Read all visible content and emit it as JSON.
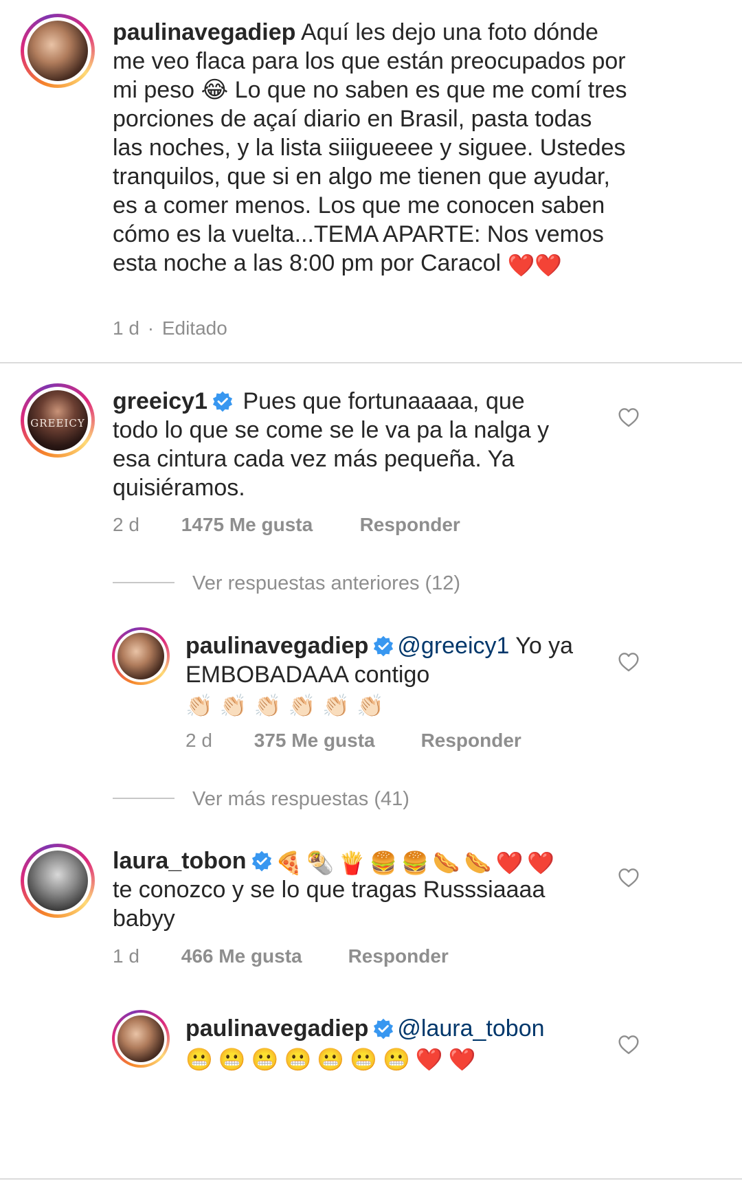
{
  "caption": {
    "username": "paulinavegadiep",
    "text": "Aquí les dejo una foto dónde me veo flaca para los que están  preocupados por mi peso 😂 Lo que no saben es que me comí tres porciones de açaí diario en Brasil, pasta todas las noches, y la lista siiigueeee y siguee. Ustedes tranquilos, que si en algo me tienen que ayudar, es a comer menos. Los que me conocen saben cómo es la vuelta...TEMA APARTE: Nos vemos esta noche a las 8:00 pm por Caracol ",
    "text_emoji": "❤️❤️",
    "time": "1 d",
    "edited": "Editado",
    "separator": "·"
  },
  "comments": [
    {
      "username": "greeicy1",
      "avatar_logo_text": "GREEICY",
      "text": "Pues que fortunaaaaa, que todo lo que se come se le va pa la nalga y esa cintura cada vez más pequeña. Ya quisiéramos.",
      "time": "2 d",
      "likes": "1475 Me gusta",
      "reply": "Responder",
      "view_previous": "Ver respuestas anteriores (12)",
      "replies": [
        {
          "username": "paulinavegadiep",
          "mention": "@greeicy1",
          "text": " Yo ya EMBOBADAAA contigo ",
          "emoji": "👏🏻👏🏻👏🏻👏🏻👏🏻👏🏻",
          "time": "2 d",
          "likes": "375 Me gusta",
          "reply": "Responder"
        }
      ],
      "view_more": "Ver más respuestas (41)"
    },
    {
      "username": "laura_tobon",
      "emoji": "🍕🌯🍟🍔🍔🌭🌭❤️❤️",
      "text": " te conozco y se lo que tragas Russsiaaaa babyy",
      "time": "1 d",
      "likes": "466 Me gusta",
      "reply": "Responder",
      "replies": [
        {
          "username": "paulinavegadiep",
          "mention": "@laura_tobon",
          "emoji": " 😬😬😬😬😬😬😬❤️❤️"
        }
      ]
    }
  ],
  "colors": {
    "text": "#262626",
    "secondary": "#8e8e8e",
    "mention": "#00376b",
    "verified": "#3897f0",
    "divider": "#dbdbdb"
  },
  "icons": {
    "verified": "verified-badge-icon",
    "like": "heart-outline-icon"
  }
}
